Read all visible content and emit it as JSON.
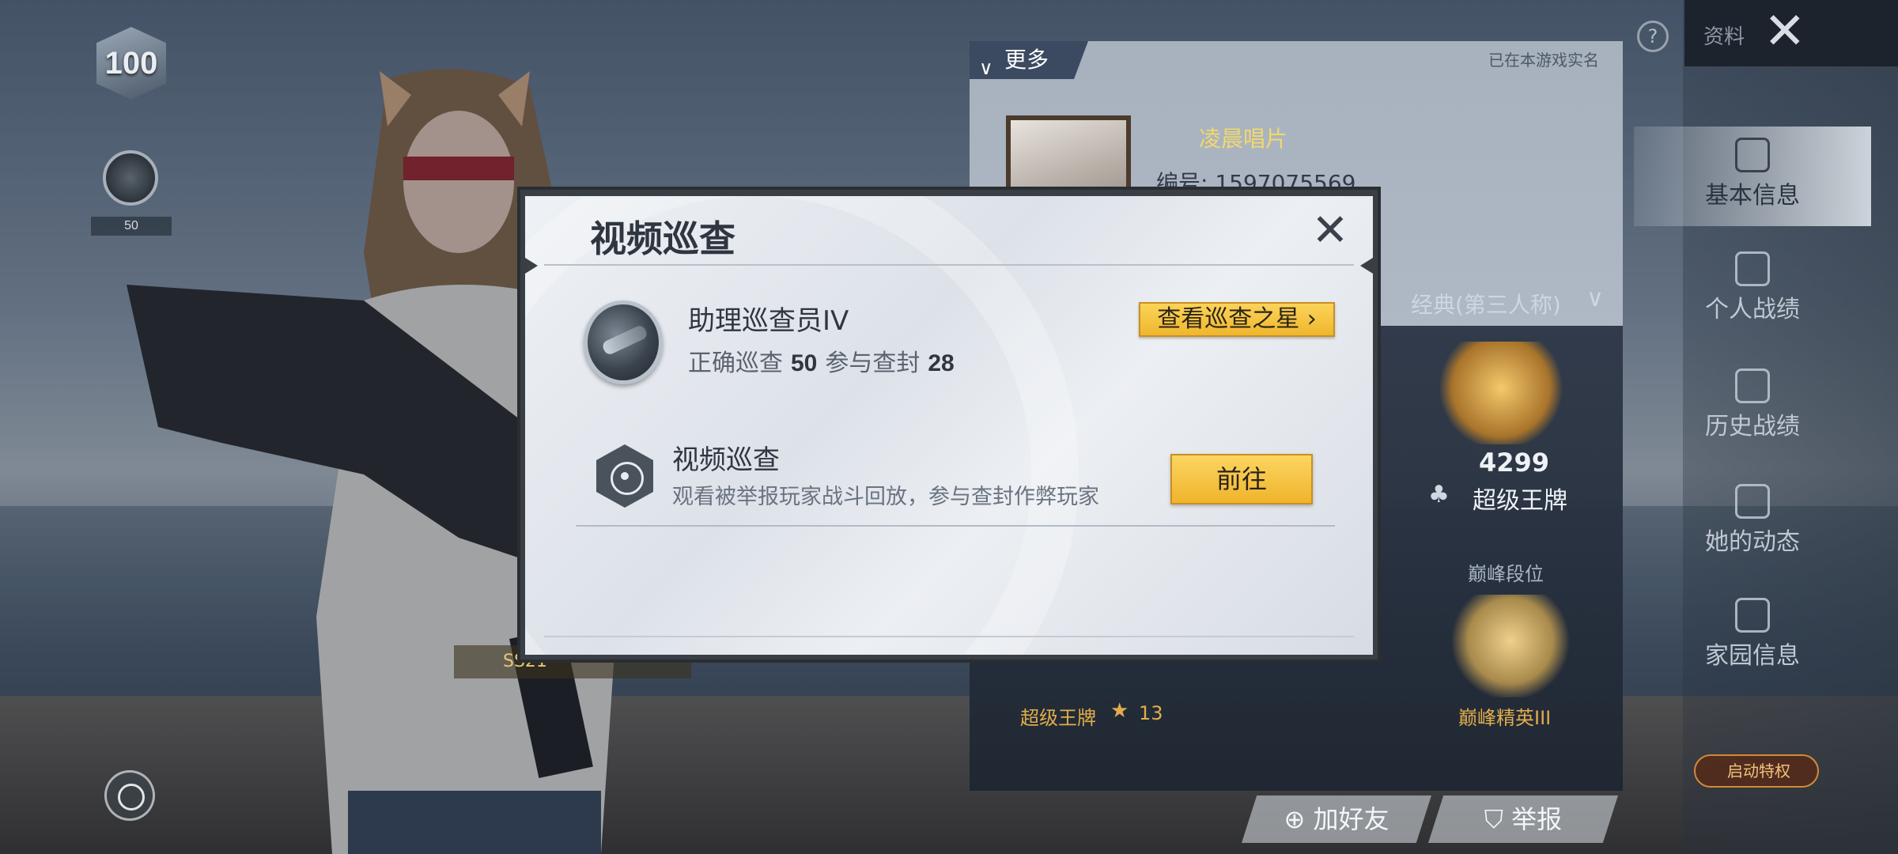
{
  "hud": {
    "level": "100",
    "patrol_count": "50",
    "season_badge": "SS21"
  },
  "profile": {
    "more_label": "更多",
    "realname_label": "已在本游戏实名",
    "nickname": "凌晨唱片",
    "uid": "编号: 1597075569",
    "mode_label": "经典(第三人称)",
    "rank_points": "4299",
    "rank_name": "超级王牌",
    "peak_label": "巅峰段位",
    "peak_name": "巅峰精英III",
    "super_rank_name": "超级王牌",
    "super_rank_stars": "13"
  },
  "sidebar": {
    "top_label": "资料",
    "items": [
      {
        "label": "基本信息",
        "icon": "user-badge-icon",
        "active": true
      },
      {
        "label": "个人战绩",
        "icon": "stats-doc-icon",
        "active": false
      },
      {
        "label": "历史战绩",
        "icon": "history-doc-icon",
        "active": false
      },
      {
        "label": "她的动态",
        "icon": "activity-icon",
        "active": false
      },
      {
        "label": "家园信息",
        "icon": "home-icon",
        "active": false
      }
    ],
    "privilege_label": "启动特权"
  },
  "bottom_actions": {
    "add_friend": "加好友",
    "report": "举报"
  },
  "modal": {
    "title": "视频巡查",
    "rank_title": "助理巡查员IV",
    "correct_label": "正确巡查",
    "correct_value": "50",
    "ban_label": "参与查封",
    "ban_value": "28",
    "star_button": "查看巡查之星",
    "video_title": "视频巡查",
    "video_desc": "观看被举报玩家战斗回放，参与查封作弊玩家",
    "go_button": "前往"
  },
  "colors": {
    "accent_yellow": "#f5c63e",
    "gold_text": "#e1ad4b",
    "modal_bg": "#e6eaef",
    "title_text": "#2f3640"
  }
}
